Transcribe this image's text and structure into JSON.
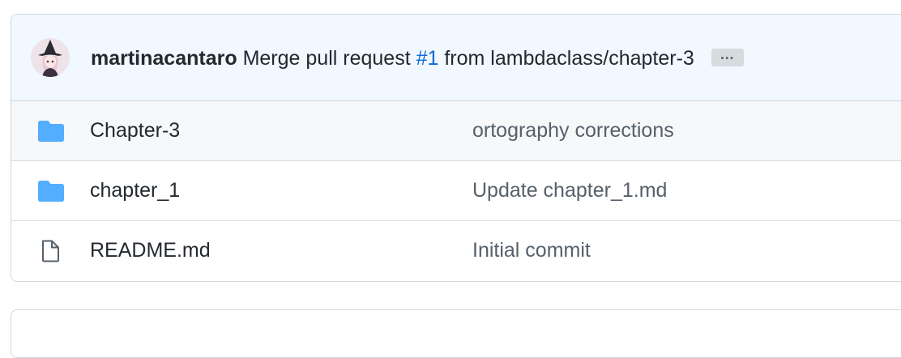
{
  "commit": {
    "author": "martinacantaro",
    "message_prefix": "Merge pull request",
    "pr_link": "#1",
    "message_suffix": "from lambdaclass/chapter-3",
    "ellipsis": "…"
  },
  "files": [
    {
      "name": "Chapter-3",
      "type": "folder",
      "icon": "folder-icon",
      "commit_message": "ortography corrections"
    },
    {
      "name": "chapter_1",
      "type": "folder",
      "icon": "folder-icon",
      "commit_message": "Update chapter_1.md"
    },
    {
      "name": "README.md",
      "type": "file",
      "icon": "file-icon",
      "commit_message": "Initial commit"
    }
  ],
  "colors": {
    "folder": "#54aeff",
    "link": "#0969da",
    "header_bg": "#f1f8ff",
    "muted_text": "#57606a"
  }
}
